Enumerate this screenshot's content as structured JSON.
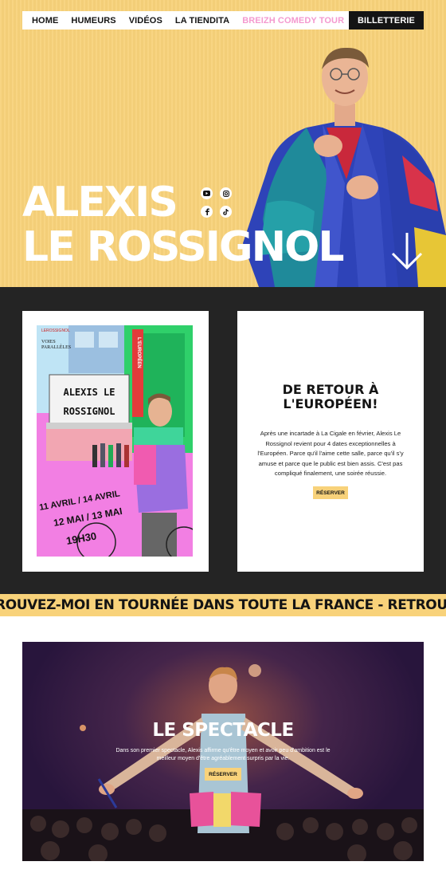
{
  "nav": {
    "items": [
      "HOME",
      "HUMEURS",
      "VIDÉOS",
      "LA TIENDITA",
      "BREIZH COMEDY TOUR"
    ],
    "ticket_label": "BILLETTERIE"
  },
  "hero": {
    "title_line1": "ALEXIS",
    "title_line2": "LE ROSSIGNOL",
    "socials": [
      "youtube-icon",
      "instagram-icon",
      "facebook-icon",
      "tiktok-icon"
    ]
  },
  "poster": {
    "logo_line1": "LE",
    "logo_line2": "ROSSIGNOL",
    "logo_line3": "VOIES",
    "logo_line4": "PARALLÈLES",
    "marquee_line1": "ALEXIS LE",
    "marquee_line2": "ROSSIGNOL",
    "sign": "L'EUROPÉEN",
    "date_line1": "11 AVRIL / 14 AVRIL",
    "date_line2": "12 MAI / 13 MAI",
    "time": "19H30"
  },
  "info": {
    "title_line1": "DE RETOUR À",
    "title_line2": "L'EUROPÉEN!",
    "text": "Après une incartade à La Cigale en février, Alexis Le Rossignol revient pour 4 dates exceptionnelles à l'Européen. Parce qu'il l'aime cette salle, parce qu'il s'y amuse et parce que le public est bien assis. C'est pas compliqué finalement, une soirée réussie.",
    "button": "RÉSERVER"
  },
  "ticker": {
    "text": "ROUVEZ-MOI EN TOURNÉE DANS TOUTE LA FRANCE - RETROUVEZ"
  },
  "spectacle": {
    "title": "LE SPECTACLE",
    "text": "Dans son premier spectacle, Alexis affirme qu'être moyen et avoir peu d'ambition est le meilleur moyen d'être agréablement surpris par la vie.",
    "button": "RÉSERVER"
  },
  "colors": {
    "yellow": "#f8d27a",
    "dark": "#242424",
    "pink_link": "#f49ad0"
  }
}
